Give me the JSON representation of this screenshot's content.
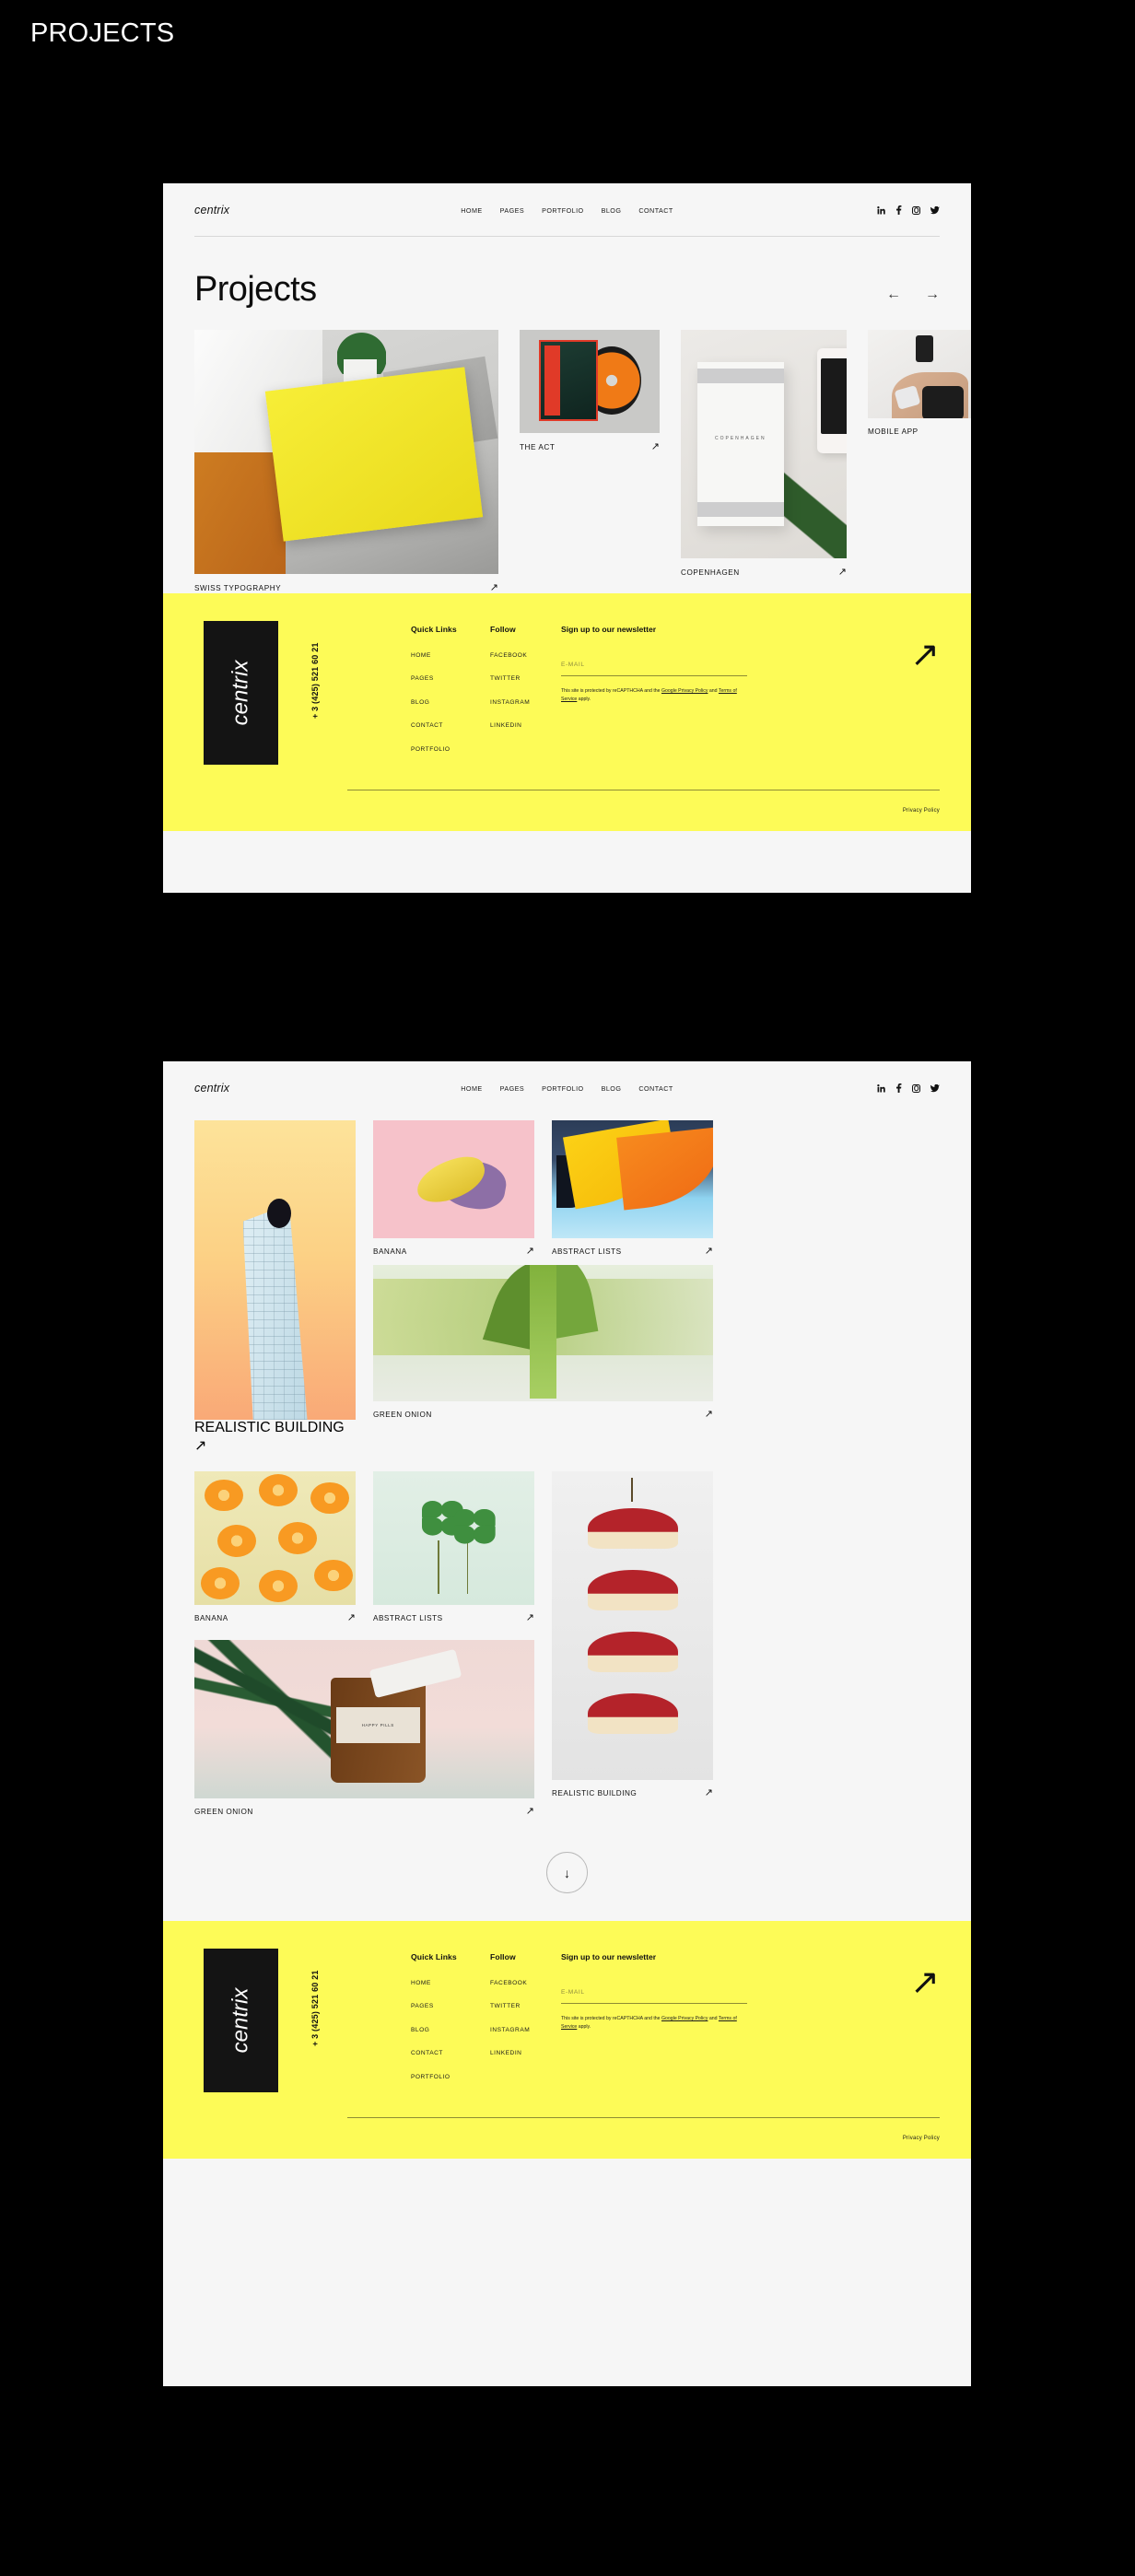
{
  "page": {
    "title": "PROJECTS",
    "background_color": "#000000",
    "accent_yellow": "#FDFB57",
    "window_background": "#F6F6F6"
  },
  "site": {
    "brand": "centrix",
    "nav": [
      {
        "label": "HOME"
      },
      {
        "label": "PAGES"
      },
      {
        "label": "PORTFOLIO"
      },
      {
        "label": "BLOG"
      },
      {
        "label": "CONTACT"
      }
    ],
    "social": [
      {
        "name": "linkedin-icon",
        "glyph": "in"
      },
      {
        "name": "facebook-icon",
        "glyph": "f"
      },
      {
        "name": "instagram-icon",
        "glyph": ""
      },
      {
        "name": "twitter-icon",
        "glyph": "✉"
      }
    ]
  },
  "hero": {
    "heading": "Projects",
    "prev_arrow": "←",
    "next_arrow": "→"
  },
  "carousel": {
    "items": [
      {
        "caption": "SWISS TYPOGRAPHY",
        "arrow": "↗"
      },
      {
        "caption": "THE ACT",
        "arrow": "↗"
      },
      {
        "caption": "COPENHAGEN",
        "arrow": "↗"
      },
      {
        "caption": "MOBILE APP",
        "arrow": "↗"
      }
    ]
  },
  "gallery": {
    "items": [
      {
        "caption": "REALISTIC BUILDING",
        "arrow": "↗"
      },
      {
        "caption": "BANANA",
        "arrow": "↗"
      },
      {
        "caption": "ABSTRACT LISTS",
        "arrow": "↗"
      },
      {
        "caption": "GREEN ONION",
        "arrow": "↗"
      },
      {
        "caption": "BANANA",
        "arrow": "↗"
      },
      {
        "caption": "ABSTRACT LISTS",
        "arrow": "↗"
      },
      {
        "caption": "GREEN ONION",
        "arrow": "↗"
      },
      {
        "caption": "REALISTIC BUILDING",
        "arrow": "↗"
      }
    ],
    "load_more_arrow": "↓"
  },
  "footer": {
    "logo": "centrix",
    "phone": "+ 3 (425) 521 60 21",
    "quick_links": {
      "title": "Quick Links",
      "items": [
        {
          "label": "HOME"
        },
        {
          "label": "PAGES"
        },
        {
          "label": "BLOG"
        },
        {
          "label": "CONTACT"
        },
        {
          "label": "PORTFOLIO"
        }
      ]
    },
    "follow": {
      "title": "Follow",
      "items": [
        {
          "label": "FACEBOOK"
        },
        {
          "label": "TWITTER"
        },
        {
          "label": "INSTAGRAM"
        },
        {
          "label": "LINKEDIN"
        }
      ]
    },
    "newsletter": {
      "title": "Sign up to our newsletter",
      "email_placeholder": "E-MAIL",
      "email_value": "",
      "submit_arrow": "↗",
      "recaptcha_prefix": "This site is protected by reCAPTHCHA and the ",
      "recaptcha_link1": "Google Privacy Policy",
      "recaptcha_mid": " and ",
      "recaptcha_link2": "Terms of Service",
      "recaptcha_suffix": " apply."
    },
    "privacy_policy": "Privacy Policy"
  },
  "artwork": {
    "copenhagen_label": "COPENHAGEN",
    "act_label": "THE ACT",
    "pills_label": "HAPPY PILLS"
  }
}
